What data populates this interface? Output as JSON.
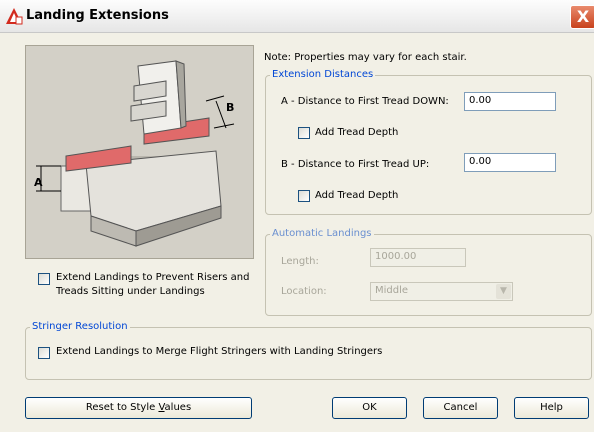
{
  "window": {
    "title": "Landing Extensions",
    "close_glyph": "X"
  },
  "note": "Note: Properties may vary for each stair.",
  "preview": {
    "label_a": "A",
    "label_b": "B"
  },
  "extend_landings_option": {
    "line1": "Extend Landings to Prevent Risers and",
    "line2": "Treads Sitting under Landings",
    "checked": false
  },
  "extension_distances": {
    "legend": "Extension Distances",
    "a_label": "A - Distance to First Tread DOWN:",
    "a_value": "0.00",
    "a_add_tread": "Add Tread Depth",
    "b_label": "B - Distance to First Tread UP:",
    "b_value": "0.00",
    "b_add_tread": "Add Tread Depth"
  },
  "automatic_landings": {
    "legend": "Automatic Landings",
    "length_label": "Length:",
    "length_value": "1000.00",
    "location_label": "Location:",
    "location_value": "Middle"
  },
  "stringer_resolution": {
    "legend": "Stringer Resolution",
    "option": "Extend Landings to Merge Flight Stringers with Landing Stringers"
  },
  "buttons": {
    "reset_pre": "Reset to Style ",
    "reset_accel": "V",
    "reset_post": "alues",
    "ok": "OK",
    "cancel": "Cancel",
    "help": "Help"
  },
  "colors": {
    "accent_blue": "#0046d5",
    "highlight_red": "#e06a6a",
    "close_red": "#c8421d"
  }
}
